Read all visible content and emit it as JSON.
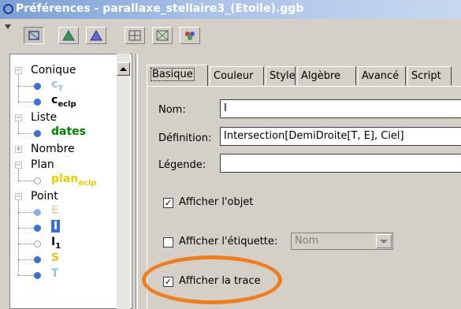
{
  "window": {
    "title": "Préférences - parallaxe_stellaire3_(Etoile).ggb",
    "icon": "geogebra-ring-icon"
  },
  "toolbar": {
    "buttons": [
      {
        "icon": "segment-objects-icon",
        "selected": true
      },
      {
        "icon": "triangle-green-icon",
        "selected": false
      },
      {
        "icon": "triangle-blue-icon",
        "selected": false
      },
      {
        "icon": "grid-table-icon",
        "selected": false
      },
      {
        "icon": "grid-dots-icon",
        "selected": false
      },
      {
        "icon": "palette-icon",
        "selected": false
      }
    ]
  },
  "tree": {
    "groups": [
      {
        "name": "Conique",
        "expander": "−",
        "items": [
          {
            "label": "c",
            "sub": "T",
            "color": "#8fc4ec",
            "dot": "#3a6fd8"
          },
          {
            "label": "c",
            "sub": "eclp",
            "color": "#000000",
            "dot": "#3a6fd8"
          }
        ]
      },
      {
        "name": "Liste",
        "expander": "−",
        "items": [
          {
            "label": "dates",
            "sub": "",
            "color": "#008000",
            "dot": "#3a6fd8"
          }
        ]
      },
      {
        "name": "Nombre",
        "expander": "+",
        "items": []
      },
      {
        "name": "Plan",
        "expander": "−",
        "items": [
          {
            "label": "plan",
            "sub": "eclp",
            "color": "#e8d000",
            "dot": "hollow"
          }
        ]
      },
      {
        "name": "Point",
        "expander": "−",
        "items": [
          {
            "label": "E",
            "sub": "",
            "color": "#e8d8a8",
            "dot": "#8faee8"
          },
          {
            "label": "I",
            "sub": "",
            "color": "#000000",
            "dot": "#3a6fd8",
            "selected": true
          },
          {
            "label": "I",
            "sub": "1",
            "color": "#000000",
            "dot": "hollow"
          },
          {
            "label": "S",
            "sub": "",
            "color": "#f0c020",
            "dot": "#3a6fd8"
          },
          {
            "label": "T",
            "sub": "",
            "color": "#8fc4ec",
            "dot": "#3a6fd8"
          }
        ]
      }
    ]
  },
  "tabs": [
    "Basique",
    "Couleur",
    "Style",
    "Algèbre",
    "Avancé",
    "Script"
  ],
  "active_tab": "Basique",
  "form": {
    "name_label": "Nom:",
    "name_value": "I",
    "definition_label": "Définition:",
    "definition_value": "Intersection[DemiDroite[T, E], Ciel]",
    "legend_label": "Légende:",
    "legend_value": "",
    "show_object_label": "Afficher l'objet",
    "show_object_checked": true,
    "show_label_label": "Afficher l'étiquette:",
    "show_label_checked": false,
    "label_mode_value": "Nom",
    "show_trace_label": "Afficher la trace",
    "show_trace_checked": true
  },
  "colors": {
    "highlight": "#f07c1c",
    "selection": "#3a6fd8"
  }
}
